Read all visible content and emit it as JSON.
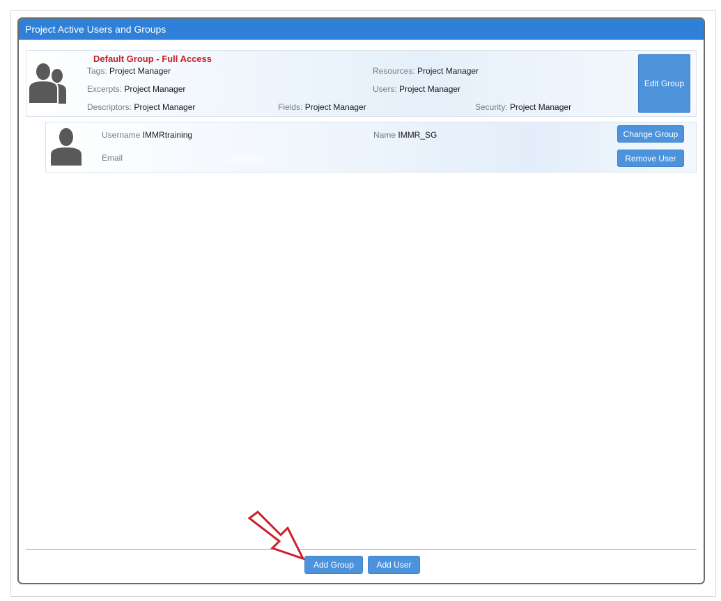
{
  "panel": {
    "title": "Project Active Users and Groups"
  },
  "group": {
    "name": "Default Group - Full Access",
    "fields": [
      {
        "label": "Tags:",
        "value": "Project Manager"
      },
      {
        "label": "Resources:",
        "value": "Project Manager"
      },
      {
        "label": "Excerpts:",
        "value": "Project Manager"
      },
      {
        "label": "Users:",
        "value": "Project Manager"
      },
      {
        "label": "Descriptors:",
        "value": "Project Manager"
      },
      {
        "label": "Fields:",
        "value": "Project Manager"
      },
      {
        "label": "Security:",
        "value": "Project Manager"
      }
    ],
    "edit_label": "Edit Group"
  },
  "user": {
    "username_label": "Username",
    "username": "IMMRtraining",
    "name_label": "Name",
    "name": "IMMR_SG",
    "email_label": "Email",
    "change_group_label": "Change Group",
    "remove_user_label": "Remove User"
  },
  "footer": {
    "add_group_label": "Add Group",
    "add_user_label": "Add User"
  },
  "colors": {
    "header": "#2f80d9",
    "button": "#4d93dc",
    "group_title": "#c8202a",
    "annotation_arrow": "#cc1f2b"
  },
  "icons": {
    "group_avatar": "users-silhouette-icon",
    "user_avatar": "user-silhouette-icon",
    "annotation": "pointer-arrow-icon"
  }
}
